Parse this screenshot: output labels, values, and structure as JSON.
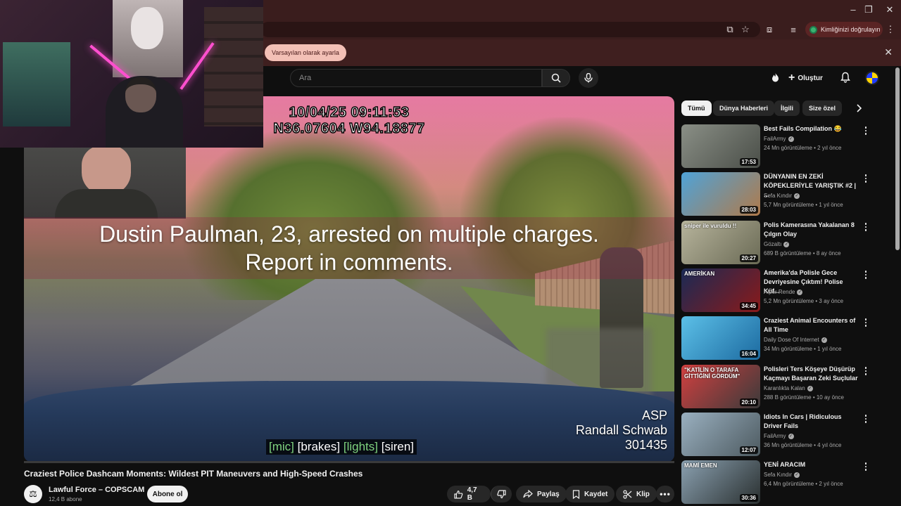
{
  "browser": {
    "infobar_button": "Varsayılan olarak ayarla",
    "profile_label": "Kimliğinizi doğrulayın"
  },
  "header": {
    "search_placeholder": "Ara",
    "create_label": "Oluştur"
  },
  "video": {
    "timestamp_line1": "10/04/25 09:11:53",
    "timestamp_line2": "N36.07604 W94.18877",
    "headline_line1": "Dustin Paulman, 23, arrested on multiple charges.",
    "headline_line2": "Report in comments.",
    "agency": "ASP",
    "officer_name": "Randall Schwab",
    "unit_number": "301435",
    "caption_mic": "[mic]",
    "caption_brakes": "[brakes]",
    "caption_lights": "[lights]",
    "caption_siren": "[siren]",
    "title": "Craziest Police Dashcam Moments: Wildest PIT Maneuvers and High-Speed Crashes"
  },
  "channel": {
    "name": "Lawful Force – COPSCAM",
    "subscribers": "12,4 B abone",
    "subscribe_label": "Abone ol"
  },
  "actions": {
    "likes": "4,7 B",
    "share": "Paylaş",
    "save": "Kaydet",
    "clip": "Klip"
  },
  "chips": [
    "Tümü",
    "Dünya Haberleri",
    "İlgili",
    "Size özel"
  ],
  "recommendations": [
    {
      "title": "Best Fails Compilation 😂",
      "channel": "FailArmy",
      "meta": "24 Mn görüntüleme • 2 yıl önce",
      "duration": "17:53",
      "color_a": "#8a8f86",
      "color_b": "#4a4e48"
    },
    {
      "title": "DÜNYANIN EN ZEKİ KÖPEKLERİYLE YARIŞTIK #2 | ...",
      "channel": "Sefa Kındır",
      "meta": "5,7 Mn görüntüleme • 1 yıl önce",
      "duration": "28:03",
      "color_a": "#4fa3d8",
      "color_b": "#b07a4a"
    },
    {
      "title": "Polis Kamerasına Yakalanan 8 Çılgın Olay",
      "channel": "Gözaltı",
      "meta": "689 B görüntüleme • 8 ay önce",
      "duration": "20:27",
      "color_a": "#b7b49c",
      "color_b": "#6a6a55",
      "overlay": "sniper ile vuruldu !!"
    },
    {
      "title": "Amerika'da Polisle Gece Devriyesine Çıktım! Polise Küf...",
      "channel": "Alper Rende",
      "meta": "5,2 Mn görüntüleme • 3 ay önce",
      "duration": "34:45",
      "color_a": "#1a2a55",
      "color_b": "#8a1a1a",
      "overlay": "AMERİKAN"
    },
    {
      "title": "Craziest Animal Encounters of All Time",
      "channel": "Daily Dose Of Internet",
      "meta": "34 Mn görüntüleme • 1 yıl önce",
      "duration": "16:04",
      "color_a": "#5cc0e8",
      "color_b": "#1c6aa0"
    },
    {
      "title": "Polisleri Ters Köşeye Düşürüp Kaçmayı Başaran Zeki Suçlular",
      "channel": "Karanlıkta Kalan",
      "meta": "288 B görüntüleme • 10 ay önce",
      "duration": "20:10",
      "color_a": "#d24040",
      "color_b": "#3a3a3a",
      "overlay": "\"KATİLİN O TARAFA GİTTİĞİNİ GÖRDÜM\""
    },
    {
      "title": "Idiots In Cars | Ridiculous Driver Fails",
      "channel": "FailArmy",
      "meta": "36 Mn görüntüleme • 4 yıl önce",
      "duration": "12:07",
      "color_a": "#9ab0c0",
      "color_b": "#4d5a60"
    },
    {
      "title": "YENİ ARACIM",
      "channel": "Sefa Kındır",
      "meta": "6,4 Mn görüntüleme • 2 yıl önce",
      "duration": "30:36",
      "color_a": "#8aa0b0",
      "color_b": "#2a3030",
      "overlay": "MAMİ EMEN"
    }
  ]
}
